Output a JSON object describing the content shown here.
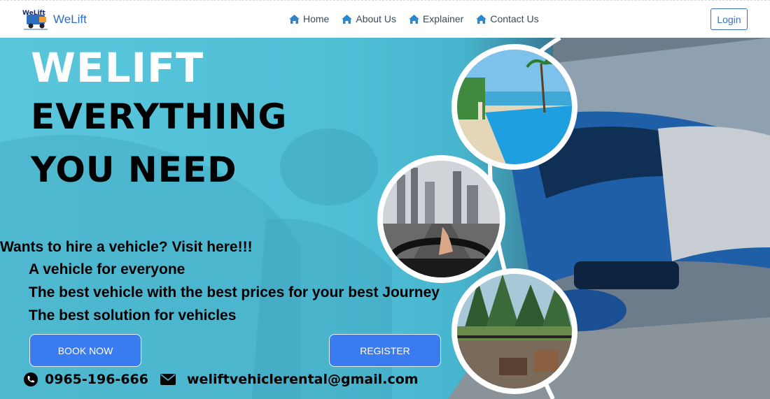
{
  "brand": {
    "name": "WeLift",
    "logo_text": "WeLift"
  },
  "nav": {
    "items": [
      {
        "label": "Home",
        "icon": "house-icon"
      },
      {
        "label": "About Us",
        "icon": "house-icon"
      },
      {
        "label": "Explainer",
        "icon": "house-icon"
      },
      {
        "label": "Contact Us",
        "icon": "house-icon"
      }
    ],
    "login_label": "Login"
  },
  "hero": {
    "headline_1": "WELIFT",
    "headline_2": "EVERYTHING",
    "headline_3": "YOU NEED",
    "tagline": "Wants to hire a vehicle? Visit here!!!",
    "bullets": [
      "A vehicle for everyone",
      "The best vehicle with the best prices for your best Journey",
      "The best solution for vehicles"
    ],
    "book_label": "BOOK NOW",
    "register_label": "REGISTER",
    "phone": "0965-196-666",
    "email": "weliftvehiclerental@gmail.com"
  },
  "colors": {
    "accent": "#3b7bf0",
    "hero_cyan": "#5ac6dc",
    "nav_text": "#3a4a5a",
    "brand": "#2f6fbf"
  }
}
